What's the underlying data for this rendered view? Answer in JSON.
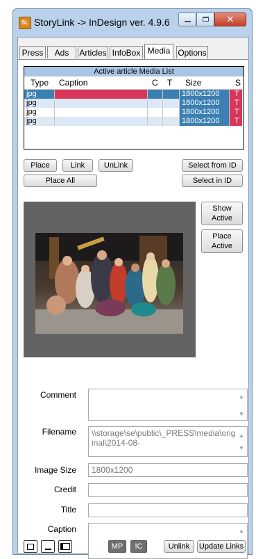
{
  "window": {
    "title": "StoryLink -> InDesign ver. 4.9.6",
    "icon_text": "SL"
  },
  "tabs": [
    {
      "label": "Press"
    },
    {
      "label": "Ads"
    },
    {
      "label": "Articles"
    },
    {
      "label": "InfoBox"
    },
    {
      "label": "Media",
      "active": true
    },
    {
      "label": "Options"
    }
  ],
  "media_list": {
    "header": "Active article Media List",
    "columns": [
      "Type",
      "Caption",
      "C",
      "T",
      "Size",
      "S"
    ],
    "rows": [
      {
        "type": "jpg",
        "caption": "",
        "c": "",
        "t": "",
        "size": "1800x1200",
        "s": "T",
        "selected": true
      },
      {
        "type": "jpg",
        "caption": "",
        "c": "",
        "t": "",
        "size": "1800x1200",
        "s": "T"
      },
      {
        "type": "jpg",
        "caption": "",
        "c": "",
        "t": "",
        "size": "1800x1200",
        "s": "T"
      },
      {
        "type": "jpg",
        "caption": "",
        "c": "",
        "t": "",
        "size": "1800x1200",
        "s": "T"
      }
    ]
  },
  "buttons": {
    "place": "Place",
    "link": "Link",
    "unlink": "UnLink",
    "select_from_id": "Select from ID",
    "place_all": "Place All",
    "select_in_id": "Select in ID",
    "show_active": "Show Active",
    "place_active": "Place Active"
  },
  "form": {
    "comment_label": "Comment",
    "comment_value": "",
    "filename_label": "Filename",
    "filename_value": "\\\\storage\\se\\public\\_PRESS\\media\\original\\2014-08-",
    "image_size_label": "Image Size",
    "image_size_value": "1800x1200",
    "credit_label": "Credit",
    "credit_value": "",
    "title_label": "Title",
    "title_value": "",
    "caption_label": "Caption",
    "caption_value": ""
  },
  "bottom": {
    "mp": "MP",
    "ic": "IC",
    "unlink": "Unlink",
    "update_links": "Update Links"
  },
  "colors": {
    "selected_row": "#3c7fb1",
    "alt_row": "#dce8f5",
    "status_red": "#d8355a",
    "header_blue": "#a9c4e4"
  }
}
